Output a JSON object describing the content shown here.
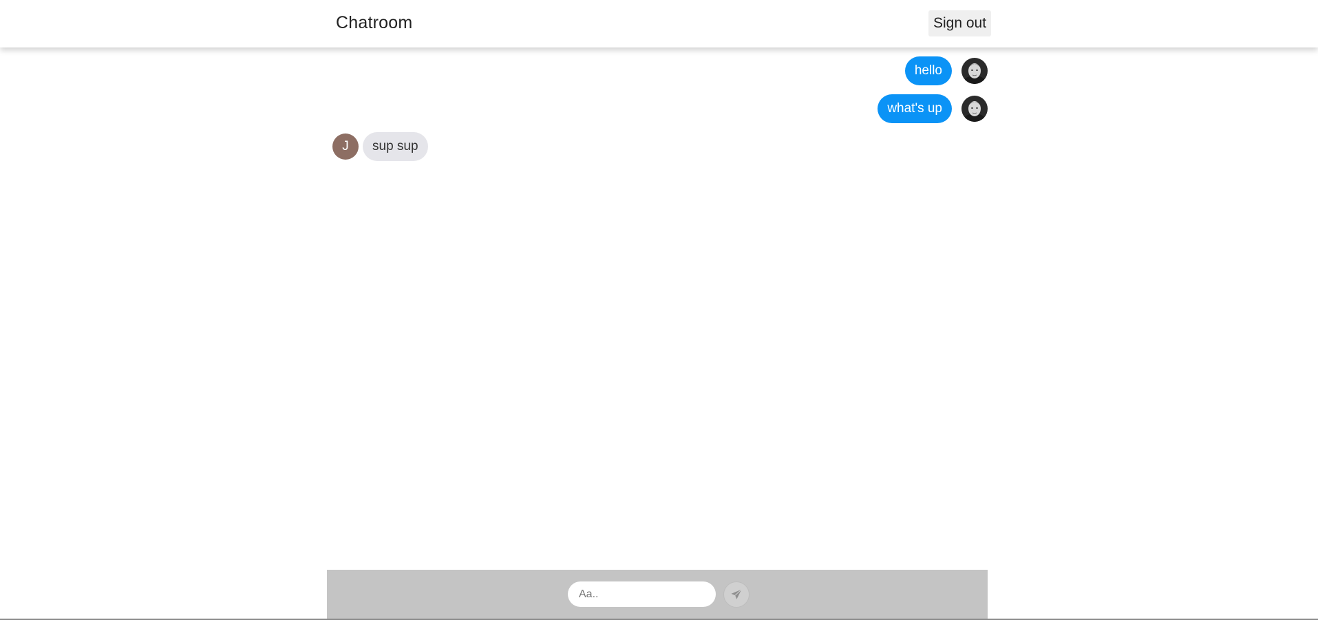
{
  "header": {
    "title": "Chatroom",
    "signout_label": "Sign out"
  },
  "messages": [
    {
      "direction": "sent",
      "text": "hello",
      "avatar": "user-photo"
    },
    {
      "direction": "sent",
      "text": "what's up",
      "avatar": "user-photo"
    },
    {
      "direction": "received",
      "text": "sup sup",
      "avatar_initial": "J"
    }
  ],
  "composer": {
    "placeholder": "Aa..",
    "value": "",
    "send_icon": "paper-plane-icon"
  },
  "colors": {
    "sent_bubble": "#0b93f6",
    "received_bubble": "#e5e5ea",
    "composer_bar": "#c4c4c4",
    "initial_avatar": "#8d6e63"
  }
}
